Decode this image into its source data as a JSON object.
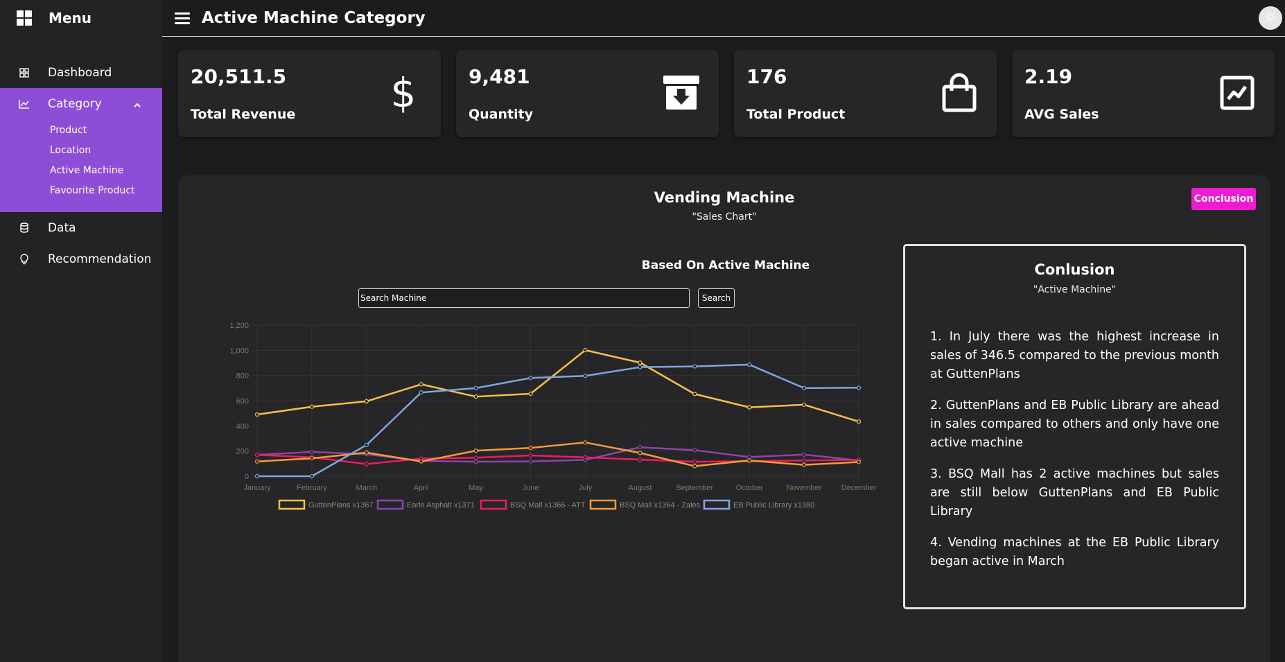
{
  "sidebar": {
    "title": "Menu",
    "items": [
      {
        "label": "Dashboard"
      },
      {
        "label": "Category"
      },
      {
        "label": "Data"
      },
      {
        "label": "Recommendation"
      }
    ],
    "category_sub": [
      "Product",
      "Location",
      "Active Machine",
      "Favourite Product"
    ]
  },
  "header": {
    "title": "Active Machine Category"
  },
  "stats": [
    {
      "value": "20,511.5",
      "label": "Total Revenue",
      "icon": "dollar-icon"
    },
    {
      "value": "9,481",
      "label": "Quantity",
      "icon": "archive-download-icon"
    },
    {
      "value": "176",
      "label": "Total Product",
      "icon": "shopping-bag-icon"
    },
    {
      "value": "2.19",
      "label": "AVG Sales",
      "icon": "trend-chart-icon"
    }
  ],
  "panel": {
    "title": "Vending Machine",
    "subtitle": "\"Sales Chart\"",
    "conclusion_button": "Conclusion",
    "chart_title": "Based On Active Machine",
    "search_placeholder": "Search Machine",
    "search_button": "Search"
  },
  "conclusion": {
    "title": "Conlusion",
    "subtitle": "\"Active Machine\"",
    "points": [
      "1. In July there was the highest increase in sales of 346.5 compared to the previous month at GuttenPlans",
      "2. GuttenPlans and EB Public Library are ahead in sales compared to others and only have one active machine",
      "3. BSQ Mall has 2 active machines but sales are still below GuttenPlans and EB Public Library",
      "4. Vending machines at the EB Public Library began active in March"
    ]
  },
  "colors": {
    "accent_purple": "#8e4dd6",
    "conclusion_pink": "#f01ad1"
  },
  "chart_data": {
    "type": "line",
    "categories": [
      "January",
      "February",
      "March",
      "April",
      "May",
      "June",
      "July",
      "August",
      "September",
      "October",
      "November",
      "December"
    ],
    "ylim": [
      0,
      1200
    ],
    "yticks": [
      "0",
      "200",
      "400",
      "600",
      "800",
      "1,000",
      "1,200"
    ],
    "grid": true,
    "legend_position": "bottom",
    "series": [
      {
        "name": "GuttenPlans x1367",
        "color": "#f7c04a",
        "values": [
          490,
          552,
          595,
          730,
          632,
          655,
          1001,
          902,
          653,
          547,
          568,
          434
        ]
      },
      {
        "name": "Earle Asphalt x1371",
        "color": "#8e44ad",
        "values": [
          170,
          193,
          175,
          122,
          115,
          118,
          130,
          230,
          207,
          153,
          172,
          125
        ]
      },
      {
        "name": "BSQ Mall x1366 - ATT",
        "color": "#e91e63",
        "values": [
          170,
          150,
          97,
          140,
          147,
          165,
          150,
          132,
          115,
          120,
          125,
          130
        ]
      },
      {
        "name": "BSQ Mall x1364 - Zales",
        "color": "#f39c39",
        "values": [
          117,
          142,
          188,
          117,
          203,
          225,
          268,
          185,
          80,
          125,
          90,
          113
        ]
      },
      {
        "name": "EB Public Library x1380",
        "color": "#7ea6e0",
        "values": [
          0,
          0,
          248,
          665,
          700,
          780,
          797,
          866,
          872,
          886,
          700,
          703
        ]
      }
    ]
  }
}
